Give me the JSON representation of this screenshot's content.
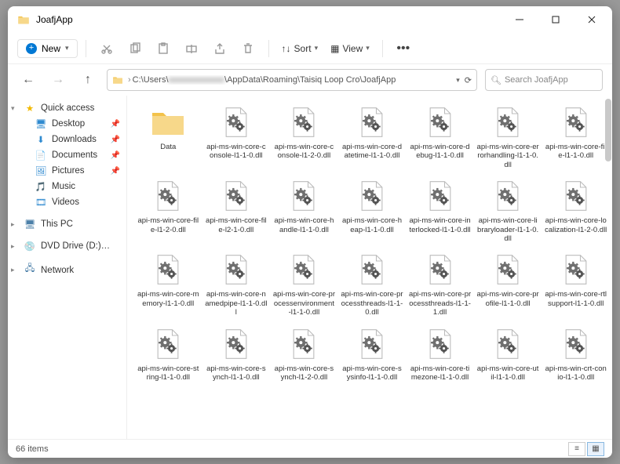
{
  "window": {
    "title": "JoafjApp"
  },
  "toolbar": {
    "new_label": "New",
    "sort_label": "Sort",
    "view_label": "View"
  },
  "address": {
    "path_prefix": "C:\\Users\\",
    "path_blurred": "xxxxxxxxxxxxx",
    "path_suffix": "\\AppData\\Roaming\\Taisiq Loop Cro\\JoafjApp",
    "search_placeholder": "Search JoafjApp"
  },
  "sidebar": {
    "quick_access": "Quick access",
    "desktop": "Desktop",
    "downloads": "Downloads",
    "documents": "Documents",
    "pictures": "Pictures",
    "music": "Music",
    "videos": "Videos",
    "this_pc": "This PC",
    "dvd": "DVD Drive (D:) CCCC",
    "network": "Network"
  },
  "folder_item": {
    "label": "Data"
  },
  "files": [
    "api-ms-win-core-console-l1-1-0.dll",
    "api-ms-win-core-console-l1-2-0.dll",
    "api-ms-win-core-datetime-l1-1-0.dll",
    "api-ms-win-core-debug-l1-1-0.dll",
    "api-ms-win-core-errorhandling-l1-1-0.dll",
    "api-ms-win-core-file-l1-1-0.dll",
    "api-ms-win-core-file-l1-2-0.dll",
    "api-ms-win-core-file-l2-1-0.dll",
    "api-ms-win-core-handle-l1-1-0.dll",
    "api-ms-win-core-heap-l1-1-0.dll",
    "api-ms-win-core-interlocked-l1-1-0.dll",
    "api-ms-win-core-libraryloader-l1-1-0.dll",
    "api-ms-win-core-localization-l1-2-0.dll",
    "api-ms-win-core-memory-l1-1-0.dll",
    "api-ms-win-core-namedpipe-l1-1-0.dll",
    "api-ms-win-core-processenvironment-l1-1-0.dll",
    "api-ms-win-core-processthreads-l1-1-0.dll",
    "api-ms-win-core-processthreads-l1-1-1.dll",
    "api-ms-win-core-profile-l1-1-0.dll",
    "api-ms-win-core-rtlsupport-l1-1-0.dll",
    "api-ms-win-core-string-l1-1-0.dll",
    "api-ms-win-core-synch-l1-1-0.dll",
    "api-ms-win-core-synch-l1-2-0.dll",
    "api-ms-win-core-sysinfo-l1-1-0.dll",
    "api-ms-win-core-timezone-l1-1-0.dll",
    "api-ms-win-core-util-l1-1-0.dll",
    "api-ms-win-crt-conio-l1-1-0.dll"
  ],
  "status": {
    "item_count": "66 items"
  }
}
